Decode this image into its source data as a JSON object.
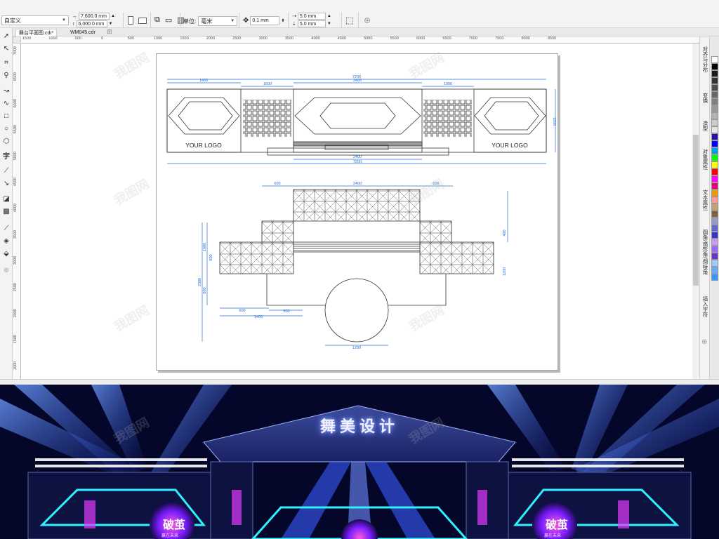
{
  "property_bar": {
    "preset": "自定义",
    "width": "7,600.0 mm",
    "height": "6,000.0 mm",
    "units_label": "单位:",
    "units_value": "毫米",
    "nudge": "0.1 mm",
    "dup_x": "5.0 mm",
    "dup_y": "5.0 mm"
  },
  "tabs": [
    {
      "label": "舞台平面图.cdr*"
    },
    {
      "label": "WM045.cdr"
    }
  ],
  "ruler_h": [
    "1500",
    "1000",
    "500",
    "0",
    "500",
    "1000",
    "1500",
    "2000",
    "2500",
    "3000",
    "3500",
    "4000",
    "4500",
    "5000",
    "5500",
    "6000",
    "6500",
    "7000",
    "7500",
    "8000",
    "8500"
  ],
  "ruler_v": [
    "7000",
    "6500",
    "6000",
    "5500",
    "5000",
    "4500",
    "4000",
    "3500",
    "3000",
    "2500",
    "2000",
    "1500",
    "1000",
    "500",
    "0"
  ],
  "drawing": {
    "elevation": {
      "dim_total_top": "7200",
      "dim_left": "1400",
      "dim_left_gap": "1600",
      "dim_center": "2400",
      "dim_right_gap": "1000",
      "dim_height": "1200",
      "dim_stage_bottom": "2400",
      "dim_total_bottom": "7200",
      "logo_left": "YOUR LOGO",
      "logo_right": "YOUR LOGO"
    },
    "plan": {
      "dim_top_left": "600",
      "dim_top_center": "2400",
      "dim_top_right": "600",
      "dim_right_top": "400",
      "dim_right": "1200",
      "dim_left_outer": "2300",
      "dim_left_1": "1000",
      "dim_left_2": "600",
      "dim_left_3": "600",
      "dim_bottom_1": "600",
      "dim_bottom_2": "500",
      "dim_bottom_total": "1400",
      "dim_circle": "1200"
    }
  },
  "docker_tabs": [
    "对齐与分布",
    "变换",
    "造型",
    "对象属性",
    "文本属性",
    "圆角/扇形角/倒棱角",
    "插入字符"
  ],
  "palette": [
    "#ffffff",
    "#000000",
    "#1a1a1a",
    "#333333",
    "#4d4d4d",
    "#666666",
    "#808080",
    "#999999",
    "#b3b3b3",
    "#cccccc",
    "#e6e6e6",
    "#2a0fa8",
    "#0000ff",
    "#00a0e9",
    "#00ff00",
    "#ffff00",
    "#ff0000",
    "#ff00ff",
    "#e4007f",
    "#f39800",
    "#ff9999",
    "#c9a26b",
    "#7f5f3f",
    "#9999cc",
    "#6666cc",
    "#3333cc",
    "#cc99ff",
    "#9966ff",
    "#6633cc",
    "#99ccff",
    "#66aaff",
    "#3399ff"
  ],
  "render": {
    "title": "舞美设计",
    "screen_text": "破茧",
    "screen_sub": "赢在未来"
  },
  "watermark": "我图网"
}
